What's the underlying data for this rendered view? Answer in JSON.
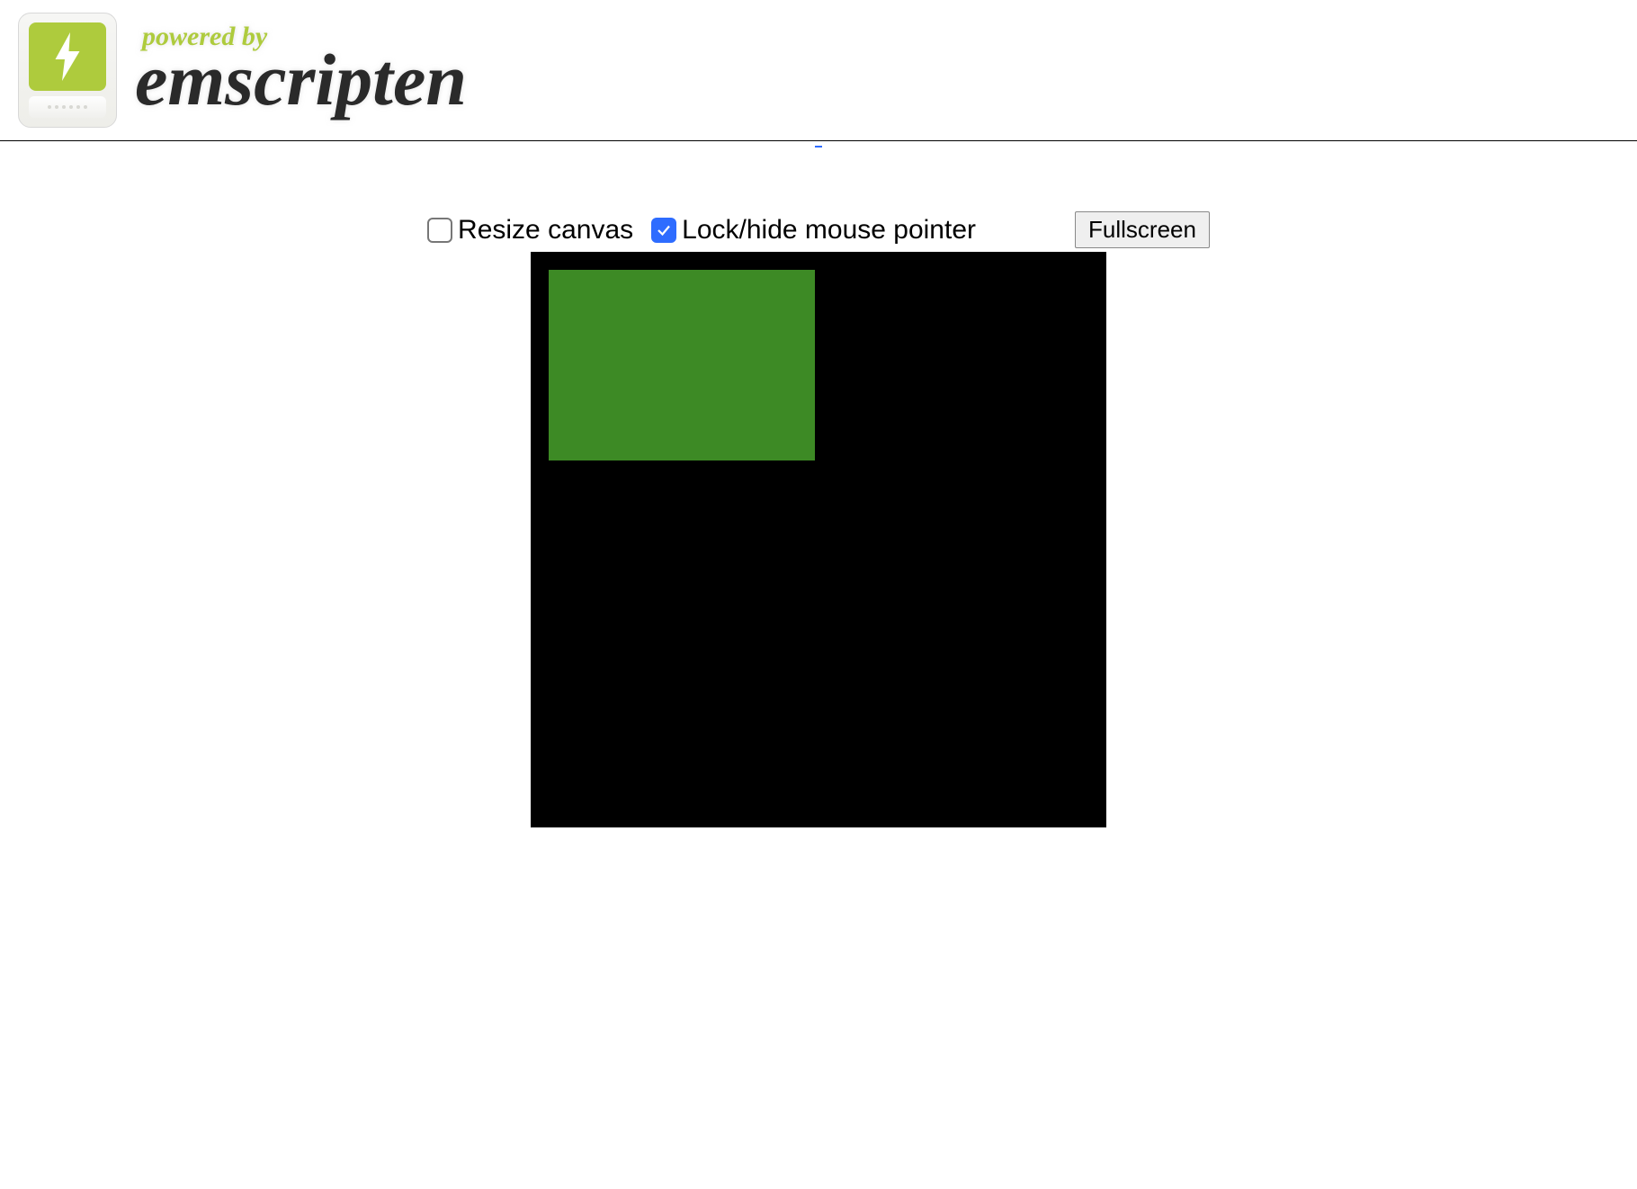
{
  "header": {
    "powered_by": "powered by",
    "brand": "emscripten"
  },
  "controls": {
    "resize_label": "Resize canvas",
    "resize_checked": false,
    "lock_label": "Lock/hide mouse pointer",
    "lock_checked": true,
    "fullscreen_label": "Fullscreen"
  },
  "canvas": {
    "bg_color": "#000000",
    "rect_color": "#3d8a25"
  }
}
